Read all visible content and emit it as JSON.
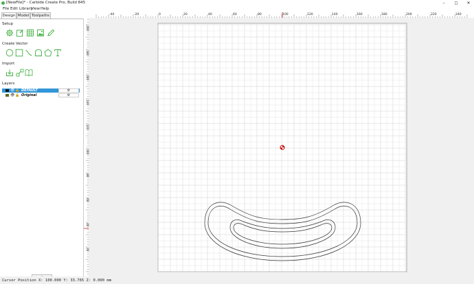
{
  "window": {
    "title": "[NewFile]* - Carbide Create Pro, Build 845",
    "controls": [
      "–",
      "◻",
      "✕"
    ]
  },
  "menu": [
    "File",
    "Edit",
    "Library",
    "View",
    "Help"
  ],
  "tabs": [
    {
      "label": "Design",
      "active": true
    },
    {
      "label": "Model",
      "active": false
    },
    {
      "label": "Toolpaths",
      "active": false
    }
  ],
  "sections": {
    "setup": "Setup",
    "create_vector": "Create Vector",
    "import": "Import",
    "layers": "Layers"
  },
  "setup_tools": [
    "gear-settings-icon",
    "edit-page-icon",
    "grid-icon",
    "image-icon",
    "pen-icon"
  ],
  "vector_tools": [
    "circle-icon",
    "rectangle-icon",
    "curve-icon",
    "polygon-icon",
    "pentagon-icon",
    "text-icon"
  ],
  "import_tools": [
    "import-icon",
    "vector-import-icon",
    "book-icon"
  ],
  "layers": [
    {
      "name": "DEFAULT",
      "color": "#1a1a1a",
      "selected": true
    },
    {
      "name": "Original",
      "color": "#5a6e1c",
      "selected": false
    }
  ],
  "add_layer_label": "+",
  "status": "Cursor Position X: 100.000 Y: 33.765 Z: 0.000 mm",
  "top_ruler_labels": [
    "-40",
    "-20",
    "0",
    "20",
    "40",
    "60",
    "80",
    "100",
    "120",
    "140",
    "160",
    "180",
    "200",
    "220",
    "240"
  ],
  "left_ruler_labels": [
    "200",
    "180",
    "160",
    "140",
    "120",
    "100",
    "80",
    "60",
    "40",
    "20"
  ],
  "colors": {
    "selection": "#3296d8",
    "tool_green": "#3fae3f",
    "cursor_marker": "#cc2222",
    "grid_line": "#cfcfcf"
  }
}
